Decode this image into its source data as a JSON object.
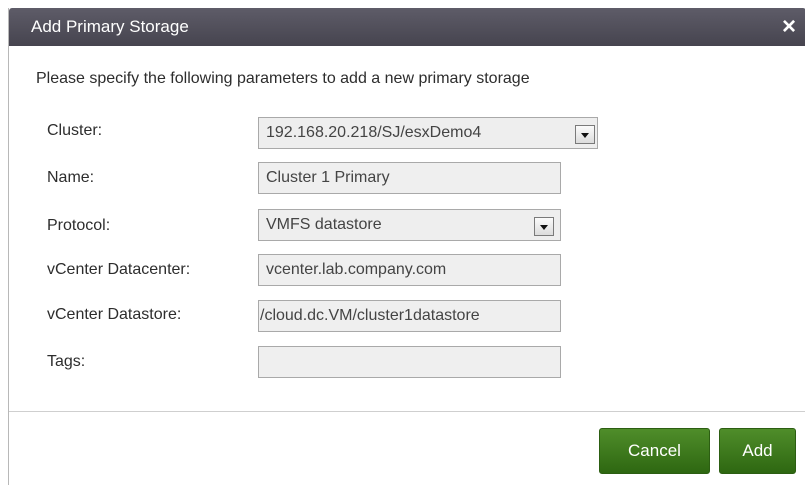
{
  "dialog": {
    "title": "Add Primary Storage",
    "close_icon": "×",
    "intro": "Please specify the following parameters to add a new primary storage"
  },
  "form": {
    "cluster": {
      "label": "Cluster:",
      "value": "192.168.20.218/SJ/esxDemo4"
    },
    "name": {
      "label": "Name:",
      "value": "Cluster 1 Primary"
    },
    "protocol": {
      "label": "Protocol:",
      "value": "VMFS datastore"
    },
    "vcenter_datacenter": {
      "label": "vCenter Datacenter:",
      "value": "vcenter.lab.company.com"
    },
    "vcenter_datastore": {
      "label": "vCenter Datastore:",
      "value": "/cloud.dc.VM/cluster1datastore"
    },
    "tags": {
      "label": "Tags:",
      "value": ""
    }
  },
  "buttons": {
    "cancel": "Cancel",
    "add": "Add"
  },
  "colors": {
    "titlebar": "#4f4d59",
    "button_green": "#3e7a1e"
  }
}
